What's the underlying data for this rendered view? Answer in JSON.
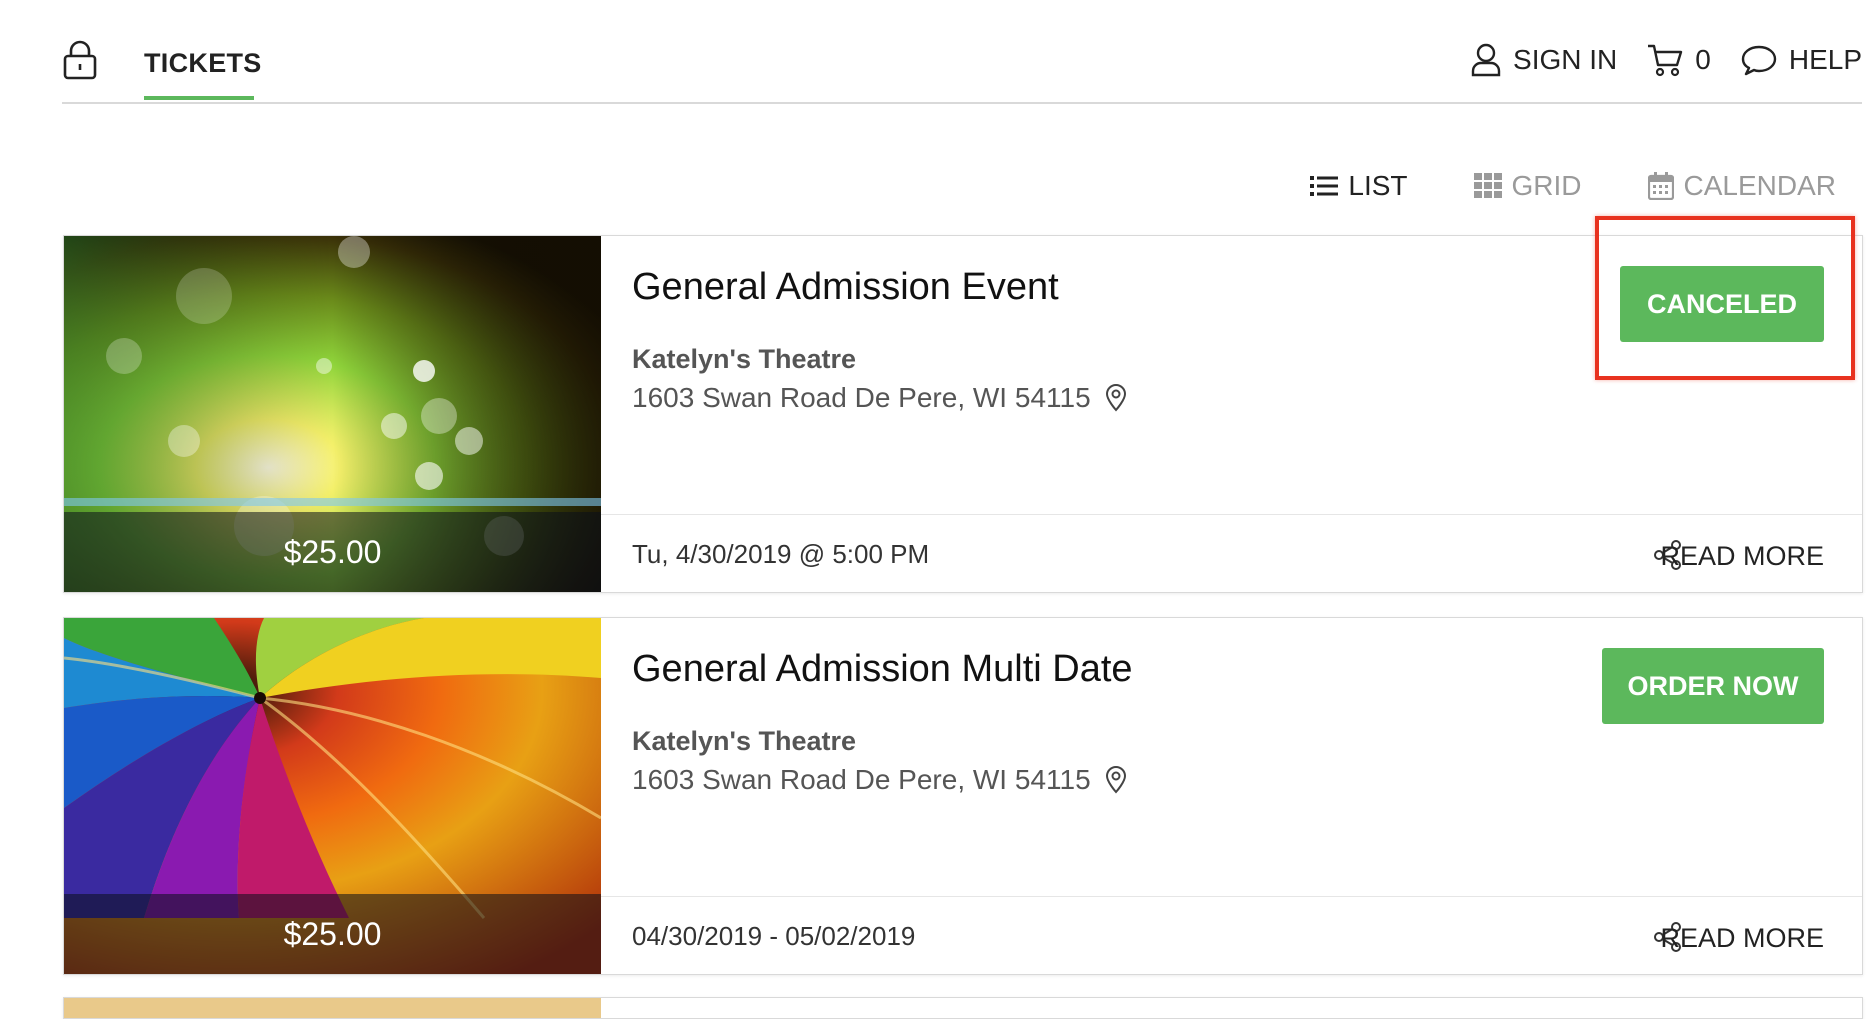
{
  "header": {
    "tab_label": "TICKETS",
    "sign_in_label": "SIGN IN",
    "cart_count": "0",
    "help_label": "HELP",
    "icons": [
      "lock-icon",
      "user-icon",
      "cart-icon",
      "chat-bubble-icon"
    ]
  },
  "views": {
    "list_label": "LIST",
    "grid_label": "GRID",
    "calendar_label": "CALENDAR",
    "active": "list"
  },
  "events": [
    {
      "title": "General Admission Event",
      "venue": "Katelyn's Theatre",
      "address": "1603 Swan Road De Pere, WI 54115",
      "price": "$25.00",
      "date": "Tu, 4/30/2019 @ 5:00 PM",
      "action_label": "CANCELED",
      "read_more_label": "READ MORE"
    },
    {
      "title": "General Admission Multi Date",
      "venue": "Katelyn's Theatre",
      "address": "1603 Swan Road De Pere, WI 54115",
      "price": "$25.00",
      "date": "04/30/2019 - 05/02/2019",
      "action_label": "ORDER NOW",
      "read_more_label": "READ MORE"
    }
  ],
  "colors": {
    "accent_green": "#5cb85c",
    "highlight_red": "#e8321f",
    "inactive_gray": "#9a9a9a"
  }
}
